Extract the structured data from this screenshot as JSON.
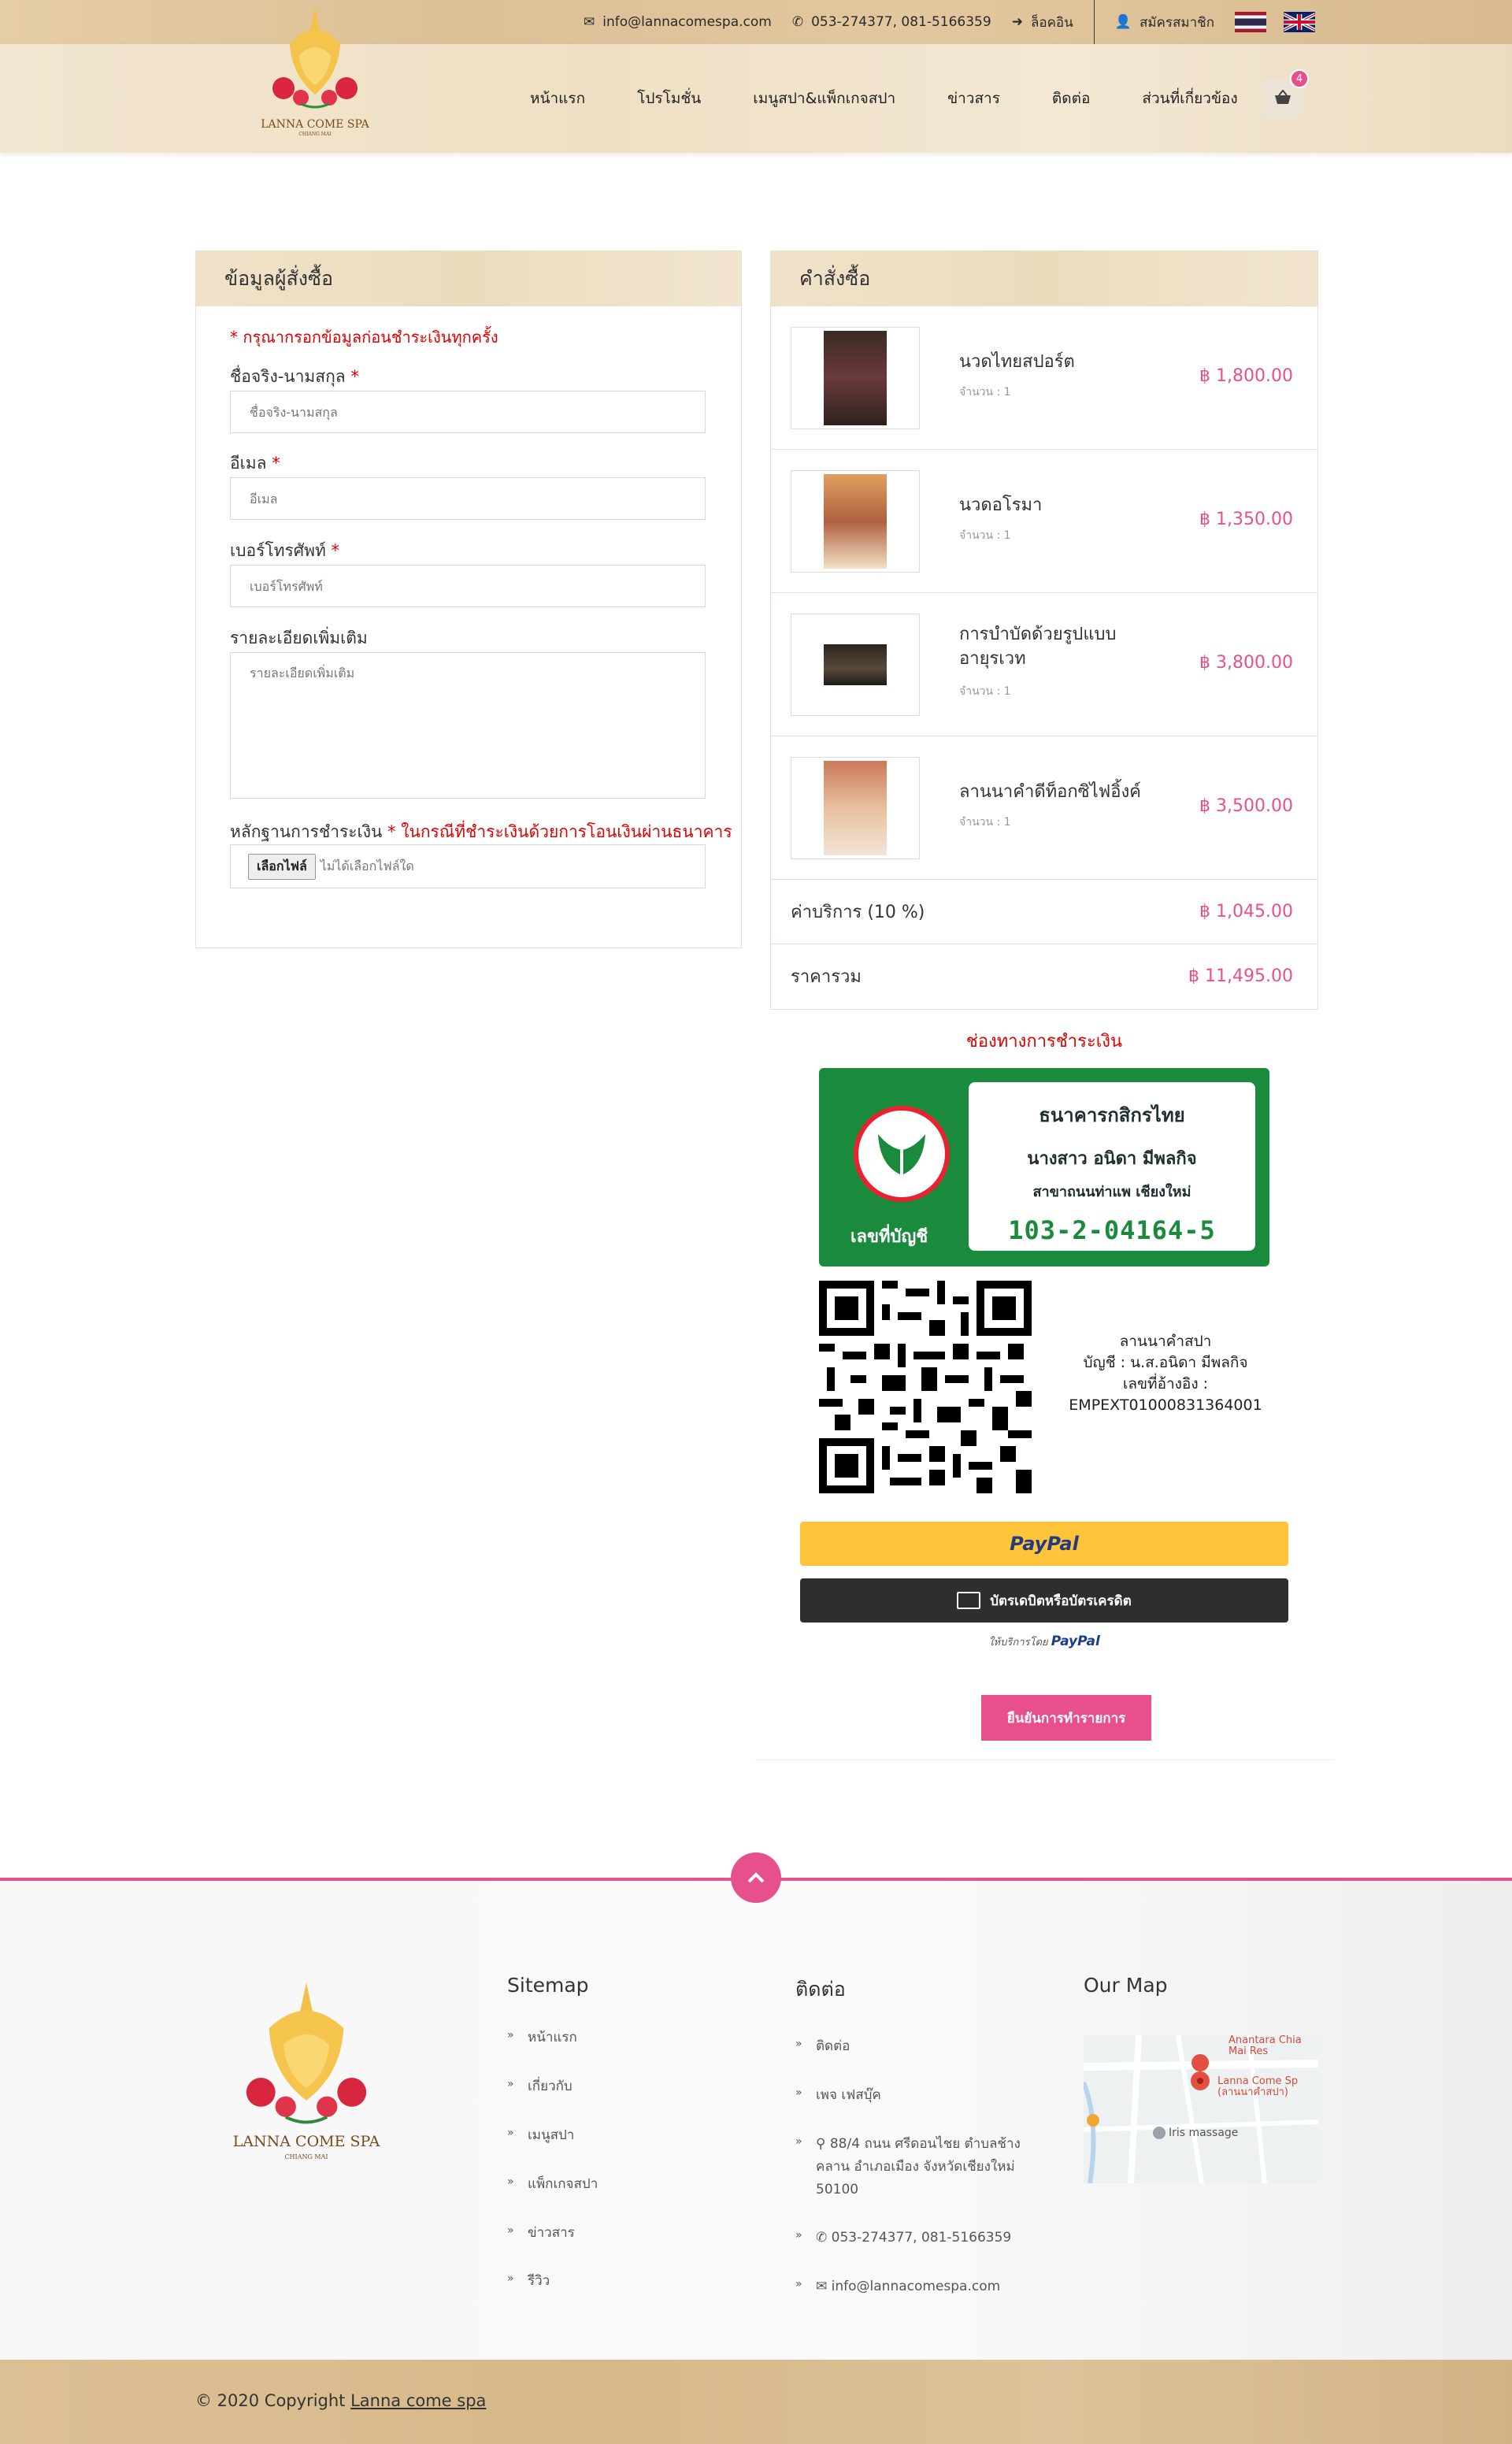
{
  "topbar": {
    "email": "info@lannacomespa.com",
    "phone": "053-274377, 081-5166359",
    "login": "ล็อคอิน",
    "register": "สมัครสมาชิก"
  },
  "brand": {
    "name": "LANNA COME SPA",
    "city": "CHIANG MAI"
  },
  "nav": {
    "items": [
      "หน้าแรก",
      "โปรโมชั่น",
      "เมนูสปา&แพ็กเกจสปา",
      "ข่าวสาร",
      "ติดต่อ",
      "ส่วนที่เกี่ยวข้อง"
    ],
    "cart_count": "4"
  },
  "form": {
    "title": "ข้อมูลผู้สั่งซื้อ",
    "notice": "* กรุณากรอกข้อมูลก่อนชำระเงินทุกครั้ง",
    "name_label": "ชื่อจริง-นามสกุล",
    "name_placeholder": "ชื่อจริง-นามสกุล",
    "email_label": "อีเมล",
    "email_placeholder": "อีเมล",
    "phone_label": "เบอร์โทรศัพท์",
    "phone_placeholder": "เบอร์โทรศัพท์",
    "details_label": "รายละเอียดเพิ่มเติม",
    "details_placeholder": "รายละเอียดเพิ่มเติม",
    "proof_label": "หลักฐานการชำระเงิน",
    "proof_note": "* ในกรณีที่ชำระเงินด้วยการโอนเงินผ่านธนาคาร",
    "file_button": "เลือกไฟล์",
    "file_status": "ไม่ได้เลือกไฟล์ใด",
    "required_mark": "*"
  },
  "order": {
    "title": "คำสั่งซื้อ",
    "items": [
      {
        "name": "นวดไทยสปอร์ต",
        "qty": "จำนวน : 1",
        "price": "฿ 1,800.00"
      },
      {
        "name": "นวดอโรมา",
        "qty": "จำนวน : 1",
        "price": "฿ 1,350.00"
      },
      {
        "name": "การบำบัดด้วยรูปแบบอายุรเวท",
        "qty": "จำนวน : 1",
        "price": "฿ 3,800.00"
      },
      {
        "name": "ลานนาคำดีท็อกซิไฟอิ้งค์",
        "qty": "จำนวน : 1",
        "price": "฿ 3,500.00"
      }
    ],
    "service_label": "ค่าบริการ (10 %)",
    "service_value": "฿ 1,045.00",
    "total_label": "ราคารวม",
    "total_value": "฿ 11,495.00"
  },
  "payment": {
    "title": "ช่องทางการชำระเงิน",
    "bank_name": "ธนาคารกสิกรไทย",
    "owner": "นางสาว อนิดา มีพลกิจ",
    "branch": "สาขาถนนท่าแพ เชียงใหม่",
    "account_number": "103-2-04164-5",
    "account_label": "เลขที่บัญชี",
    "qr_line1": "ลานนาคำสปา",
    "qr_line2": "บัญชี : น.ส.อนิดา มีพลกิจ",
    "qr_line3": "เลขที่อ้างอิง :",
    "qr_line4": "EMPEXT01000831364001",
    "paypal_label": "PayPal",
    "card_label": "บัตรเดบิตหรือบัตรเครดิต",
    "powered_prefix": "ให้บริการโดย",
    "powered_brand": "PayPal",
    "confirm_label": "ยืนยันการทำรายการ"
  },
  "footer": {
    "sitemap_title": "Sitemap",
    "sitemap": [
      "หน้าแรก",
      "เกี่ยวกับ",
      "เมนูสปา",
      "แพ็กเกจสปา",
      "ข่าวสาร",
      "รีวิว"
    ],
    "contact_title": "ติดต่อ",
    "contact_link": "ติดต่อ",
    "facebook": "เพจ เฟสบุ๊ค",
    "address": "88/4 ถนน ศรีดอนไชย ตำบลช้างคลาน อำเภอเมือง จังหวัดเชียงใหม่ 50100",
    "phone": "053-274377, 081-5166359",
    "email": "info@lannacomespa.com",
    "map_title": "Our Map",
    "map_labels": {
      "resort": "Anantara Chia\nMai Res",
      "spa": "Lanna Come Sp\n(ลานนาคำสปา)",
      "iris": "Iris massage"
    },
    "copyright_prefix": "© 2020 Copyright",
    "copyright_link": "Lanna come spa"
  },
  "colors": {
    "accent": "#e8508c",
    "bank_green": "#1a8a3d",
    "paypal_yellow": "#ffc439"
  },
  "icons": [
    "envelope-icon",
    "phone-icon",
    "sign-in-icon",
    "user-plus-icon",
    "cart-icon",
    "chevron-up-icon",
    "map-marker-icon",
    "credit-card-icon"
  ]
}
